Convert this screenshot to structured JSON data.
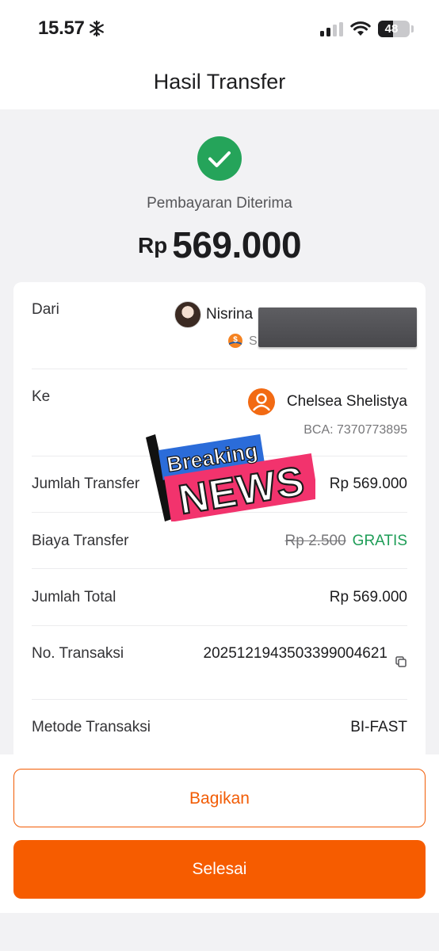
{
  "status_bar": {
    "time": "15.57",
    "battery_percent": 48,
    "battery_text": "48",
    "weather_icon": "snowflake-icon",
    "signal_icon": "cellular-signal-icon",
    "wifi_icon": "wifi-icon"
  },
  "header": {
    "title": "Hasil Transfer"
  },
  "success": {
    "icon": "checkmark-circle-icon",
    "label": "Pembayaran Diterima",
    "currency": "Rp",
    "amount": "569.000"
  },
  "details": {
    "from": {
      "label": "Dari",
      "name": "Nisrina",
      "bank_initial": "S",
      "bank_icon": "bank-logo-icon"
    },
    "to": {
      "label": "Ke",
      "name": "Chelsea Shelistya",
      "account": "BCA: 7370773895",
      "avatar_icon": "person-avatar-icon"
    },
    "transfer_amount": {
      "label": "Jumlah Transfer",
      "value": "Rp 569.000"
    },
    "transfer_fee": {
      "label": "Biaya Transfer",
      "old_value": "Rp 2.500",
      "value": "GRATIS"
    },
    "total": {
      "label": "Jumlah Total",
      "value": "Rp 569.000"
    },
    "transaction_no": {
      "label": "No. Transaksi",
      "value": "20251219435033990046​21",
      "copy_icon": "copy-icon"
    },
    "method": {
      "label": "Metode Transaksi",
      "value": "BI-FAST"
    }
  },
  "sticker": {
    "line1": "Breaking",
    "line2": "NEWS"
  },
  "actions": {
    "share_label": "Bagikan",
    "done_label": "Selesai"
  },
  "colors": {
    "accent": "#f65c00",
    "success": "#25a45a",
    "free": "#1e9d57"
  }
}
